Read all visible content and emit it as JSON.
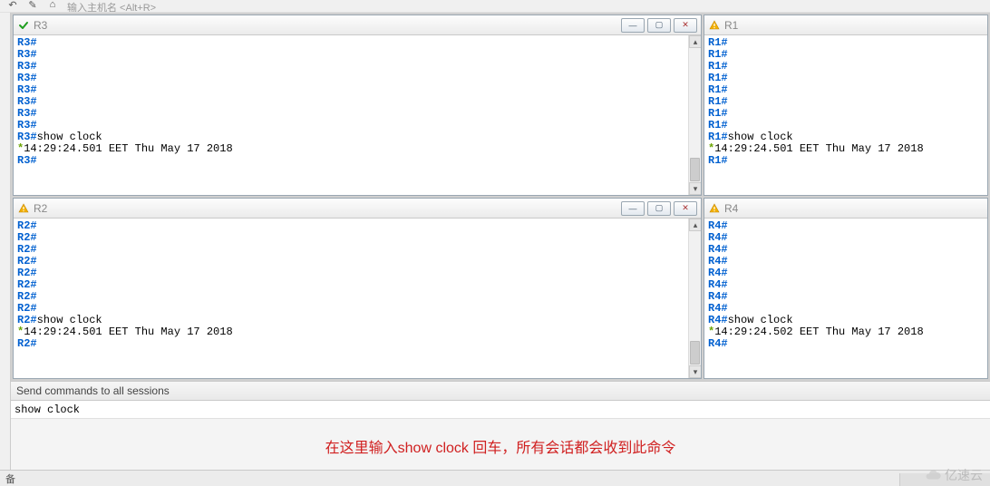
{
  "toolbar": {
    "placeholder": "输入主机名 <Alt+R>"
  },
  "panes": [
    {
      "id": "r3",
      "title": "R3",
      "status": "ok",
      "has_win_btns": true,
      "has_scroll": true,
      "prompts": [
        "R3#",
        "R3#",
        "R3#",
        "R3#",
        "R3#",
        "R3#",
        "R3#",
        "R3#"
      ],
      "cmd_prompt": "R3#",
      "cmd": "show clock",
      "output_mark": "*",
      "output": "14:29:24.501 EET Thu May 17 2018",
      "trail_prompt": "R3#"
    },
    {
      "id": "r1",
      "title": "R1",
      "status": "warn",
      "has_win_btns": false,
      "has_scroll": false,
      "prompts": [
        "R1#",
        "R1#",
        "R1#",
        "R1#",
        "R1#",
        "R1#",
        "R1#",
        "R1#"
      ],
      "cmd_prompt": "R1#",
      "cmd": "show clock",
      "output_mark": "*",
      "output": "14:29:24.501 EET Thu May 17 2018",
      "trail_prompt": "R1#"
    },
    {
      "id": "r2",
      "title": "R2",
      "status": "warn",
      "has_win_btns": true,
      "has_scroll": true,
      "prompts": [
        "R2#",
        "R2#",
        "R2#",
        "R2#",
        "R2#",
        "R2#",
        "R2#",
        "R2#"
      ],
      "cmd_prompt": "R2#",
      "cmd": "show clock",
      "output_mark": "*",
      "output": "14:29:24.501 EET Thu May 17 2018",
      "trail_prompt": "R2#"
    },
    {
      "id": "r4",
      "title": "R4",
      "status": "warn",
      "has_win_btns": false,
      "has_scroll": false,
      "prompts": [
        "R4#",
        "R4#",
        "R4#",
        "R4#",
        "R4#",
        "R4#",
        "R4#",
        "R4#"
      ],
      "cmd_prompt": "R4#",
      "cmd": "show clock",
      "output_mark": "*",
      "output": "14:29:24.502 EET Thu May 17 2018",
      "trail_prompt": "R4#"
    }
  ],
  "send": {
    "header": "Send commands to all sessions",
    "value": "show clock"
  },
  "annotation": "在这里输入show clock 回车，所有会话都会收到此命令",
  "status": {
    "text": "备"
  },
  "watermark": "亿速云"
}
